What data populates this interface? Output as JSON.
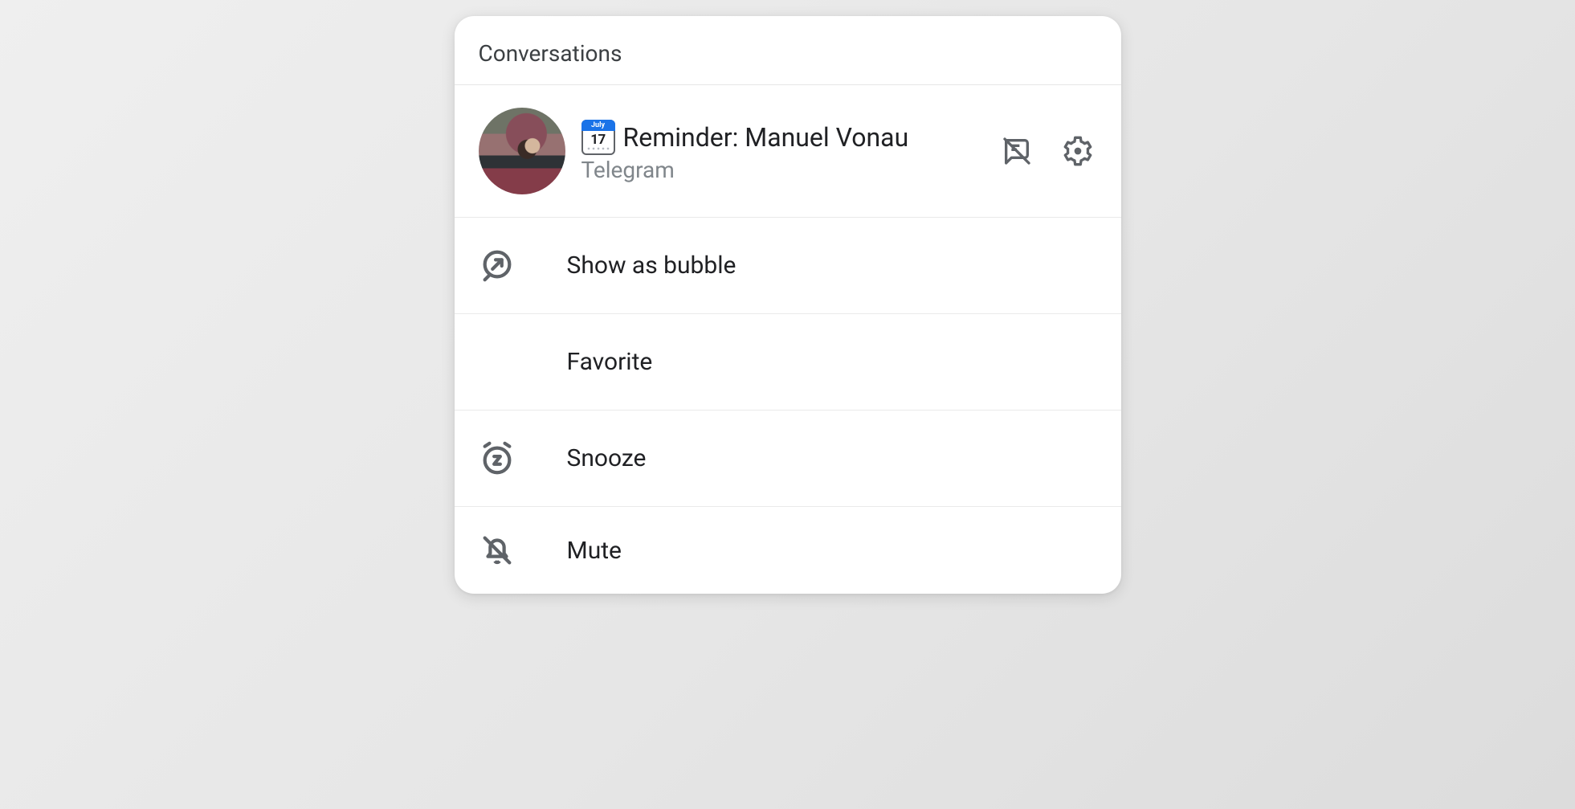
{
  "header": {
    "title": "Conversations"
  },
  "conversation": {
    "calendar": {
      "month": "July",
      "day": "17"
    },
    "title": "Reminder: Manuel Vonau",
    "app": "Telegram"
  },
  "options": {
    "bubble": "Show as bubble",
    "favorite": "Favorite",
    "snooze": "Snooze",
    "mute": "Mute"
  }
}
